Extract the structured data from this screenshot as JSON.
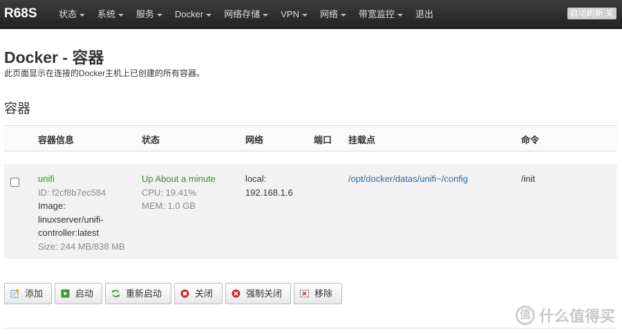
{
  "navbar": {
    "brand": "R68S",
    "items": [
      {
        "label": "状态",
        "dropdown": true
      },
      {
        "label": "系统",
        "dropdown": true
      },
      {
        "label": "服务",
        "dropdown": true
      },
      {
        "label": "Docker",
        "dropdown": true
      },
      {
        "label": "网络存储",
        "dropdown": true
      },
      {
        "label": "VPN",
        "dropdown": true
      },
      {
        "label": "网络",
        "dropdown": true
      },
      {
        "label": "带宽监控",
        "dropdown": true
      },
      {
        "label": "退出",
        "dropdown": false
      }
    ],
    "autorefresh_label": "自动刷新 关"
  },
  "page": {
    "title": "Docker - 容器",
    "description": "此页面显示在连接的Docker主机上已创建的所有容器。",
    "section_title": "容器"
  },
  "table": {
    "headers": [
      "容器信息",
      "状态",
      "网络",
      "端口",
      "挂载点",
      "命令"
    ],
    "rows": [
      {
        "name": "unifi",
        "id": "ID: f2cf8b7ec584",
        "image_label": "Image:",
        "image_line1": "linuxserver/unifi-",
        "image_line2": "controller:latest",
        "size": "Size: 244 MB/838 MB",
        "status": "Up About a minute",
        "cpu": "CPU: 19.41%",
        "mem": "MEM: 1.0 GB",
        "network_line1": "local:",
        "network_line2": "192.168.1.6",
        "ports": "",
        "mount": "/opt/docker/datas/unifi~/config",
        "command": "/init"
      }
    ]
  },
  "actions": {
    "add": "添加",
    "start": "启动",
    "restart": "重新启动",
    "stop": "关闭",
    "kill": "强制关闭",
    "remove": "移除"
  },
  "watermark": {
    "logo_char": "值",
    "text": "什么值得买"
  },
  "colors": {
    "navbar_bg": "#2b2b2b",
    "status_green": "#3c8a2c",
    "link_blue": "#2a6aa8"
  }
}
